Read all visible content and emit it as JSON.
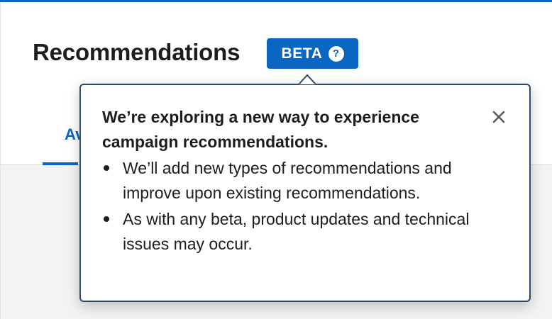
{
  "header": {
    "title": "Recommendations",
    "beta_label": "BETA",
    "help_icon_glyph": "?"
  },
  "tabs": [
    {
      "label": "Av",
      "active": true
    }
  ],
  "popover": {
    "heading": "We’re exploring a new way to experience campaign recommendations.",
    "close_glyph": "×",
    "bullets": [
      "We’ll add new types of recommendations and improve upon existing recommendations.",
      "As with any beta, product updates and technical issues may occur."
    ]
  },
  "colors": {
    "brand_blue": "#0a66c2",
    "text": "#1d1d1d",
    "popover_border": "#2f4a6d",
    "content_bg": "#f3f3f3"
  },
  "icons": {
    "help": "question-circle-icon",
    "close": "close-icon"
  }
}
